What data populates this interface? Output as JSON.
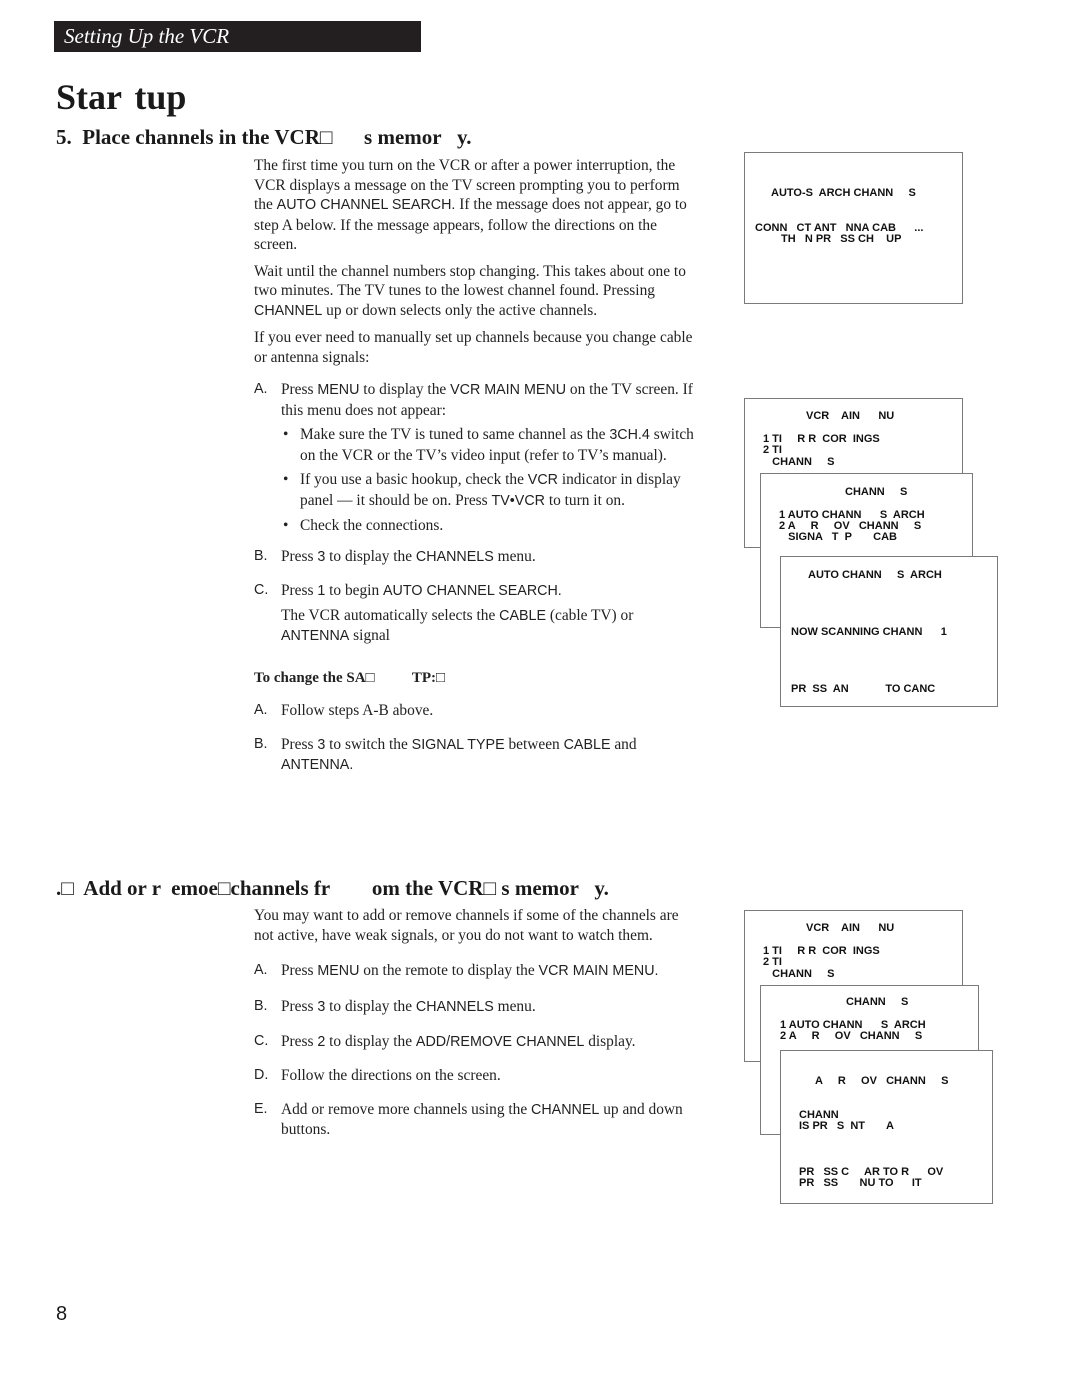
{
  "section_banner": "Setting Up the VCR",
  "page_title": "Star  tup",
  "step5": {
    "heading": "5.  Place channels in the VCR□      s memor   y.",
    "paragraphs": [
      {
        "parts": [
          "The first time you turn on the VCR or after a power interruption, the VCR displays a message on the TV screen prompting you to perform the ",
          "AUTO CHANNEL SEARCH.",
          "  If the message does not appear, go to step A below. If the message appears, follow the directions on the screen."
        ]
      },
      {
        "parts": [
          "Wait until the channel numbers stop changing.  This takes about one to two minutes.  The TV tunes to the lowest channel found. Pressing ",
          "CHANNEL",
          " up or down selects only the active channels."
        ]
      },
      {
        "parts": [
          "If you ever need to manually set up channels because you change cable or antenna signals:"
        ]
      }
    ],
    "steps": {
      "a": {
        "letter": "A.",
        "t1": "Press ",
        "k1": "MENU",
        "t2": " to display the ",
        "k2": "VCR MAIN MENU",
        "t3": " on the TV screen. If this menu does not appear:"
      },
      "bullets": [
        {
          "k": "",
          "pre": "Make sure the TV is tuned to same channel as the ",
          "k1": "3CH.4",
          "post": " switch on the VCR or the TV’s video input (refer to TV’s manual)."
        },
        {
          "pre": "If you use a basic hookup, check the ",
          "k1": "VCR",
          "mid": " indicator in display panel — it should be on.  Press ",
          "k2": "TV•VCR",
          "post": " to turn it on."
        },
        {
          "pre": "Check the connections."
        }
      ],
      "b": {
        "letter": "B.",
        "t1": "Press ",
        "k1": "3",
        "t2": " to display the ",
        "k2": "CHANNELS",
        "t3": " menu."
      },
      "c": {
        "letter": "C.",
        "t1": "Press ",
        "k1": "1",
        "t2": " to begin ",
        "k2": "AUTO CHANNEL SEARCH.",
        "n1": "The VCR automatically selects the ",
        "nk1": "CABLE",
        "n2": " (cable TV) or ",
        "nk2": "ANTENNA",
        "n3": " signal"
      }
    },
    "signal_type": {
      "subheading": "To change the SA□          TP:□",
      "a": {
        "letter": "A.",
        "text": "Follow steps A-B above."
      },
      "b": {
        "letter": "B.",
        "t1": "Press ",
        "k1": "3",
        "t2": " to switch the ",
        "k2": "SIGNAL TYPE",
        "t3": " between ",
        "k3": "CABLE",
        "t4": " and ",
        "k4": "ANTENNA."
      }
    },
    "screens": {
      "auto_search_prompt": {
        "title": "AUTO-S  ARCH CHANN     S",
        "line1": "CONN   CT ANT   NNA CAB      ...",
        "line2": "TH   N PR   SS CH    UP"
      },
      "main_menu": {
        "title": "VCR    AIN      NU",
        "items": [
          "1 TI     R R  COR  INGS",
          "2 TI",
          "   CHANN     S"
        ]
      },
      "channels_menu": {
        "title": "CHANN     S",
        "items": [
          "1 AUTO CHANN      S  ARCH",
          "2 A     R     OV   CHANN     S",
          "   SIGNA   T  P       CAB"
        ]
      },
      "auto_search": {
        "title": "AUTO CHANN     S  ARCH",
        "status": "NOW SCANNING CHANN      1",
        "footer": "PR  SS  AN            TO CANC"
      }
    }
  },
  "step6": {
    "heading": ".□  Add or r  emoe□channels fr        om the VCR□ s memor   y.",
    "intro": "You may want to add or remove channels if some of the channels are not active, have weak signals, or you do not want to watch them.",
    "steps": {
      "a": {
        "letter": "A.",
        "t1": "Press ",
        "k1": "MENU",
        "t2": " on the remote to display the ",
        "k2": "VCR MAIN MENU."
      },
      "b": {
        "letter": "B.",
        "t1": "Press ",
        "k1": "3",
        "t2": " to display the ",
        "k2": "CHANNELS",
        "t3": " menu."
      },
      "c": {
        "letter": "C.",
        "t1": "Press ",
        "k1": "2",
        "t2": " to display the ",
        "k2": "ADD/REMOVE CHANNEL",
        "t3": " display."
      },
      "d": {
        "letter": "D.",
        "text": "Follow the directions on the screen."
      },
      "e": {
        "letter": "E.",
        "t1": "Add or remove more channels using the ",
        "k1": "CHANNEL",
        "t2": " up and down buttons."
      }
    },
    "screens": {
      "main_menu": {
        "title": "VCR    AIN      NU",
        "items": [
          "1 TI     R R  COR  INGS",
          "2 TI",
          "   CHANN     S"
        ]
      },
      "channels_menu": {
        "title": "CHANN     S",
        "items": [
          "1 AUTO CHANN      S  ARCH",
          "2 A     R     OV   CHANN     S"
        ]
      },
      "add_remove": {
        "title": "A     R     OV   CHANN     S",
        "status1": "CHANN",
        "status2": "IS PR   S  NT       A",
        "footer1": "PR   SS C     AR TO R      OV",
        "footer2": "PR   SS       NU TO      IT"
      }
    }
  },
  "page_number": "8"
}
